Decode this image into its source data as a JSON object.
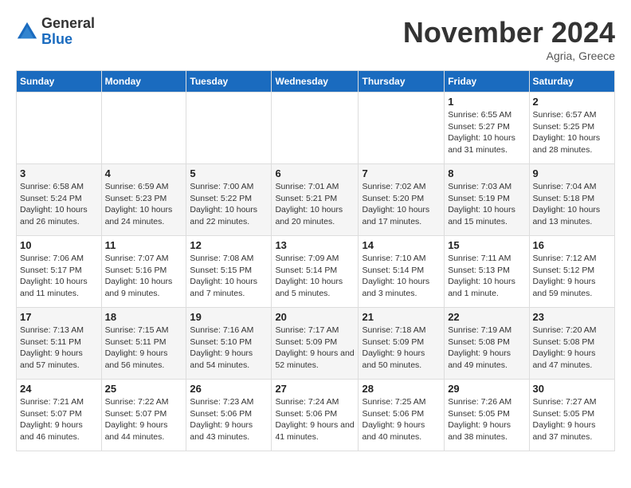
{
  "logo": {
    "general": "General",
    "blue": "Blue"
  },
  "title": "November 2024",
  "location": "Agria, Greece",
  "days_of_week": [
    "Sunday",
    "Monday",
    "Tuesday",
    "Wednesday",
    "Thursday",
    "Friday",
    "Saturday"
  ],
  "weeks": [
    [
      {
        "day": "",
        "info": ""
      },
      {
        "day": "",
        "info": ""
      },
      {
        "day": "",
        "info": ""
      },
      {
        "day": "",
        "info": ""
      },
      {
        "day": "",
        "info": ""
      },
      {
        "day": "1",
        "info": "Sunrise: 6:55 AM\nSunset: 5:27 PM\nDaylight: 10 hours and 31 minutes."
      },
      {
        "day": "2",
        "info": "Sunrise: 6:57 AM\nSunset: 5:25 PM\nDaylight: 10 hours and 28 minutes."
      }
    ],
    [
      {
        "day": "3",
        "info": "Sunrise: 6:58 AM\nSunset: 5:24 PM\nDaylight: 10 hours and 26 minutes."
      },
      {
        "day": "4",
        "info": "Sunrise: 6:59 AM\nSunset: 5:23 PM\nDaylight: 10 hours and 24 minutes."
      },
      {
        "day": "5",
        "info": "Sunrise: 7:00 AM\nSunset: 5:22 PM\nDaylight: 10 hours and 22 minutes."
      },
      {
        "day": "6",
        "info": "Sunrise: 7:01 AM\nSunset: 5:21 PM\nDaylight: 10 hours and 20 minutes."
      },
      {
        "day": "7",
        "info": "Sunrise: 7:02 AM\nSunset: 5:20 PM\nDaylight: 10 hours and 17 minutes."
      },
      {
        "day": "8",
        "info": "Sunrise: 7:03 AM\nSunset: 5:19 PM\nDaylight: 10 hours and 15 minutes."
      },
      {
        "day": "9",
        "info": "Sunrise: 7:04 AM\nSunset: 5:18 PM\nDaylight: 10 hours and 13 minutes."
      }
    ],
    [
      {
        "day": "10",
        "info": "Sunrise: 7:06 AM\nSunset: 5:17 PM\nDaylight: 10 hours and 11 minutes."
      },
      {
        "day": "11",
        "info": "Sunrise: 7:07 AM\nSunset: 5:16 PM\nDaylight: 10 hours and 9 minutes."
      },
      {
        "day": "12",
        "info": "Sunrise: 7:08 AM\nSunset: 5:15 PM\nDaylight: 10 hours and 7 minutes."
      },
      {
        "day": "13",
        "info": "Sunrise: 7:09 AM\nSunset: 5:14 PM\nDaylight: 10 hours and 5 minutes."
      },
      {
        "day": "14",
        "info": "Sunrise: 7:10 AM\nSunset: 5:14 PM\nDaylight: 10 hours and 3 minutes."
      },
      {
        "day": "15",
        "info": "Sunrise: 7:11 AM\nSunset: 5:13 PM\nDaylight: 10 hours and 1 minute."
      },
      {
        "day": "16",
        "info": "Sunrise: 7:12 AM\nSunset: 5:12 PM\nDaylight: 9 hours and 59 minutes."
      }
    ],
    [
      {
        "day": "17",
        "info": "Sunrise: 7:13 AM\nSunset: 5:11 PM\nDaylight: 9 hours and 57 minutes."
      },
      {
        "day": "18",
        "info": "Sunrise: 7:15 AM\nSunset: 5:11 PM\nDaylight: 9 hours and 56 minutes."
      },
      {
        "day": "19",
        "info": "Sunrise: 7:16 AM\nSunset: 5:10 PM\nDaylight: 9 hours and 54 minutes."
      },
      {
        "day": "20",
        "info": "Sunrise: 7:17 AM\nSunset: 5:09 PM\nDaylight: 9 hours and 52 minutes."
      },
      {
        "day": "21",
        "info": "Sunrise: 7:18 AM\nSunset: 5:09 PM\nDaylight: 9 hours and 50 minutes."
      },
      {
        "day": "22",
        "info": "Sunrise: 7:19 AM\nSunset: 5:08 PM\nDaylight: 9 hours and 49 minutes."
      },
      {
        "day": "23",
        "info": "Sunrise: 7:20 AM\nSunset: 5:08 PM\nDaylight: 9 hours and 47 minutes."
      }
    ],
    [
      {
        "day": "24",
        "info": "Sunrise: 7:21 AM\nSunset: 5:07 PM\nDaylight: 9 hours and 46 minutes."
      },
      {
        "day": "25",
        "info": "Sunrise: 7:22 AM\nSunset: 5:07 PM\nDaylight: 9 hours and 44 minutes."
      },
      {
        "day": "26",
        "info": "Sunrise: 7:23 AM\nSunset: 5:06 PM\nDaylight: 9 hours and 43 minutes."
      },
      {
        "day": "27",
        "info": "Sunrise: 7:24 AM\nSunset: 5:06 PM\nDaylight: 9 hours and 41 minutes."
      },
      {
        "day": "28",
        "info": "Sunrise: 7:25 AM\nSunset: 5:06 PM\nDaylight: 9 hours and 40 minutes."
      },
      {
        "day": "29",
        "info": "Sunrise: 7:26 AM\nSunset: 5:05 PM\nDaylight: 9 hours and 38 minutes."
      },
      {
        "day": "30",
        "info": "Sunrise: 7:27 AM\nSunset: 5:05 PM\nDaylight: 9 hours and 37 minutes."
      }
    ]
  ]
}
